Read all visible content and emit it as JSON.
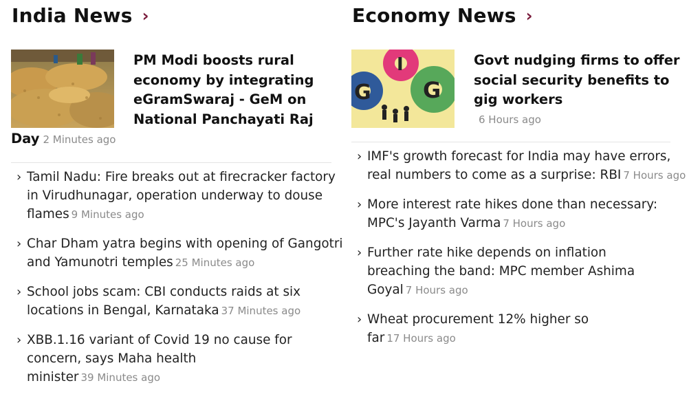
{
  "colors": {
    "accent": "#7a1c3c",
    "time": "#8a8a8a",
    "divider": "#e4e4e4"
  },
  "india": {
    "title": "India News",
    "chevron": "›",
    "lead": {
      "headline": "PM Modi boosts rural economy by integrating eGramSwaraj - GeM on National Panchayati Raj",
      "headline_tail": "Day",
      "time": "2 Minutes ago"
    },
    "items": [
      {
        "text": "Tamil Nadu: Fire breaks out at firecracker factory in Virudhunagar, operation underway to douse flames",
        "time": "9 Minutes ago"
      },
      {
        "text": "Char Dham yatra begins with opening of Gangotri and Yamunotri temples",
        "time": "25 Minutes ago"
      },
      {
        "text": "School jobs scam: CBI conducts raids at six locations in Bengal, Karnataka",
        "time": "37 Minutes ago"
      },
      {
        "text": "XBB.1.16 variant of Covid 19 no cause for concern, says Maha health minister",
        "time": "39 Minutes ago"
      }
    ]
  },
  "economy": {
    "title": "Economy News",
    "chevron": "›",
    "lead": {
      "headline": "Govt nudging firms to offer social security benefits to gig workers",
      "time": "6 Hours ago"
    },
    "items": [
      {
        "text": "IMF's growth forecast for India may have errors, real numbers to come as a surprise: RBI",
        "time": "7 Hours ago"
      },
      {
        "text": "More interest rate hikes done than necessary: MPC's Jayanth Varma",
        "time": "7 Hours ago"
      },
      {
        "text": "Further rate hike depends on inflation breaching the band: MPC member Ashima Goyal",
        "time": "7 Hours ago"
      },
      {
        "text": "Wheat procurement 12% higher so far",
        "time": "17 Hours ago"
      }
    ]
  }
}
